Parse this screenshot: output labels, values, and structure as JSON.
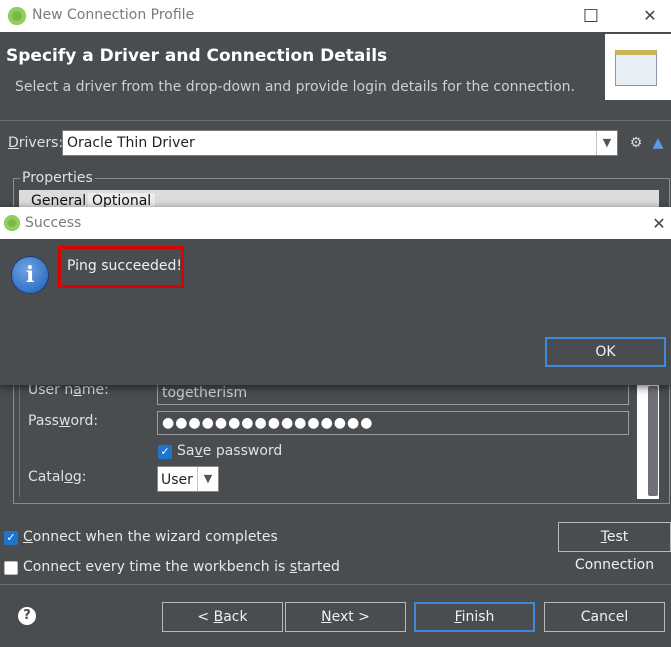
{
  "window": {
    "title": "New Connection Profile"
  },
  "header": {
    "title": "Specify a Driver and Connection Details",
    "subtitle": "Select a driver from the drop-down and provide login details for the connection."
  },
  "drivers": {
    "label_first": "D",
    "label_rest": "rivers:",
    "selected": "Oracle Thin Driver"
  },
  "properties": {
    "group_label": "Properties",
    "tabs": [
      "General",
      "Optional"
    ]
  },
  "form": {
    "username_label_a": "User n",
    "username_label_u": "a",
    "username_label_b": "me:",
    "username_value": "togetherism",
    "password_label_a": "Pass",
    "password_label_u": "w",
    "password_label_b": "ord:",
    "password_value": "●●●●●●●●●●●●●●●●",
    "save_password_a": "Sa",
    "save_password_u": "v",
    "save_password_b": "e password",
    "save_password_checked": true,
    "catalog_label_a": "Catal",
    "catalog_label_u": "o",
    "catalog_label_b": "g:",
    "catalog_value": "User"
  },
  "options": {
    "connect_on_complete_u": "C",
    "connect_on_complete_rest": "onnect when the wizard completes",
    "connect_on_complete_checked": true,
    "connect_every_time_a": "Connect every time the workbench is ",
    "connect_every_time_u": "s",
    "connect_every_time_b": "tarted",
    "connect_every_time_checked": false
  },
  "buttons": {
    "test_connection_u": "T",
    "test_connection_rest": "est Connection",
    "back_a": "< ",
    "back_u": "B",
    "back_b": "ack",
    "next_u": "N",
    "next_rest": "ext >",
    "finish_u": "F",
    "finish_rest": "inish",
    "cancel": "Cancel"
  },
  "dialog": {
    "title": "Success",
    "message": "Ping succeeded!",
    "ok": "OK",
    "close": "✕"
  },
  "icons": {
    "minimize": "—",
    "maximize": "☐",
    "close": "✕",
    "info": "i",
    "help": "?"
  },
  "colors": {
    "accent": "#1e74d0",
    "highlight_box": "#e00000",
    "background": "#4a4d50"
  }
}
